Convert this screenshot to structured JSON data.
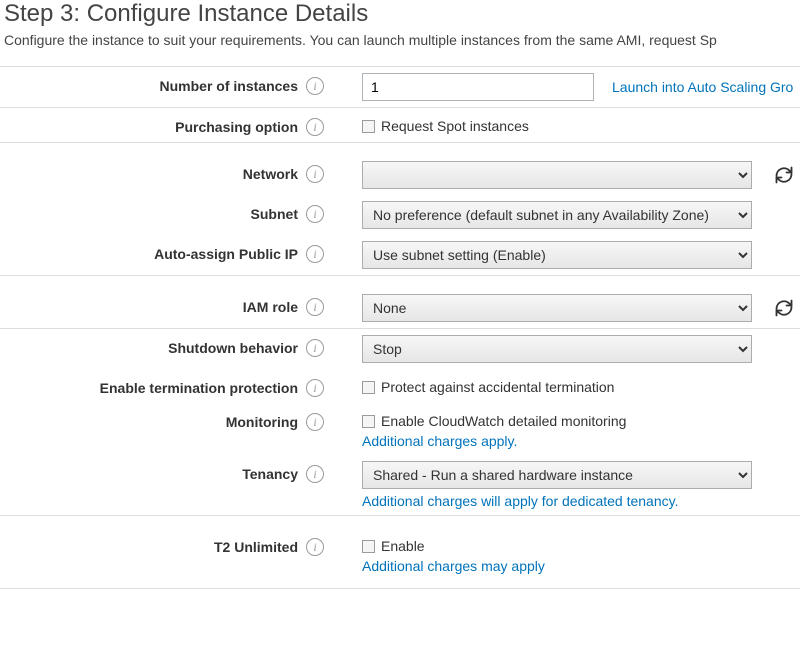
{
  "page": {
    "title": "Step 3: Configure Instance Details",
    "subtitle": "Configure the instance to suit your requirements. You can launch multiple instances from the same AMI, request Sp"
  },
  "labels": {
    "number_of_instances": "Number of instances",
    "purchasing_option": "Purchasing option",
    "network": "Network",
    "subnet": "Subnet",
    "auto_assign_ip": "Auto-assign Public IP",
    "iam_role": "IAM role",
    "shutdown_behavior": "Shutdown behavior",
    "termination_protection": "Enable termination protection",
    "monitoring": "Monitoring",
    "tenancy": "Tenancy",
    "t2_unlimited": "T2 Unlimited"
  },
  "fields": {
    "number_of_instances_value": "1",
    "launch_asg_link": "Launch into Auto Scaling Gro",
    "request_spot_label": "Request Spot instances",
    "network_selected": "",
    "subnet_selected": "No preference (default subnet in any Availability Zone)",
    "auto_assign_ip_selected": "Use subnet setting (Enable)",
    "iam_role_selected": "None",
    "shutdown_selected": "Stop",
    "termination_cb_label": "Protect against accidental termination",
    "monitoring_cb_label": "Enable CloudWatch detailed monitoring",
    "monitoring_hint": "Additional charges apply.",
    "tenancy_selected": "Shared - Run a shared hardware instance",
    "tenancy_hint": "Additional charges will apply for dedicated tenancy.",
    "t2_cb_label": "Enable",
    "t2_hint": "Additional charges may apply"
  }
}
